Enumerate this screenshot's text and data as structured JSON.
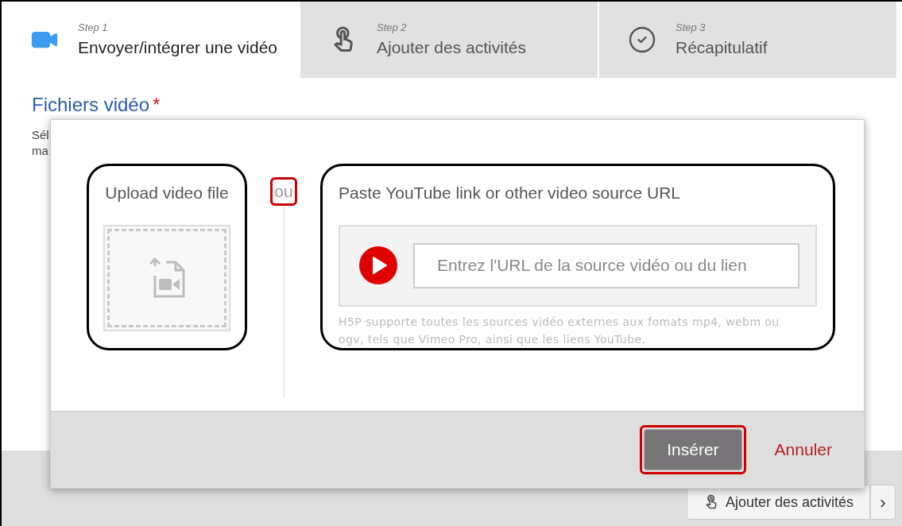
{
  "steps": [
    {
      "step": "Step 1",
      "title": "Envoyer/intégrer une vidéo",
      "selected": true,
      "kind": "video"
    },
    {
      "step": "Step 2",
      "title": "Ajouter des activités",
      "selected": false,
      "kind": "tap"
    },
    {
      "step": "Step 3",
      "title": "Récapitulatif",
      "selected": false,
      "kind": "check"
    }
  ],
  "section": {
    "heading": "Fichiers vidéo",
    "required_mark": "*",
    "description_lines": [
      "Sél",
      "ma"
    ]
  },
  "footer": {
    "next_button": "Ajouter des activités",
    "arrow": "›"
  },
  "dialog": {
    "upload": {
      "title": "Upload video file"
    },
    "separator": "ou",
    "url": {
      "title": "Paste YouTube link or other video source URL",
      "placeholder": "Entrez l'URL de la source vidéo ou du lien",
      "hint": "H5P supporte toutes les sources vidéo externes aux fomats mp4, webm ou ogv, tels que Vimeo Pro, ainsi que les liens YouTube."
    },
    "buttons": [
      {
        "label": "Insérer",
        "kind": "primary"
      },
      {
        "label": "Annuler",
        "kind": "link"
      }
    ]
  }
}
